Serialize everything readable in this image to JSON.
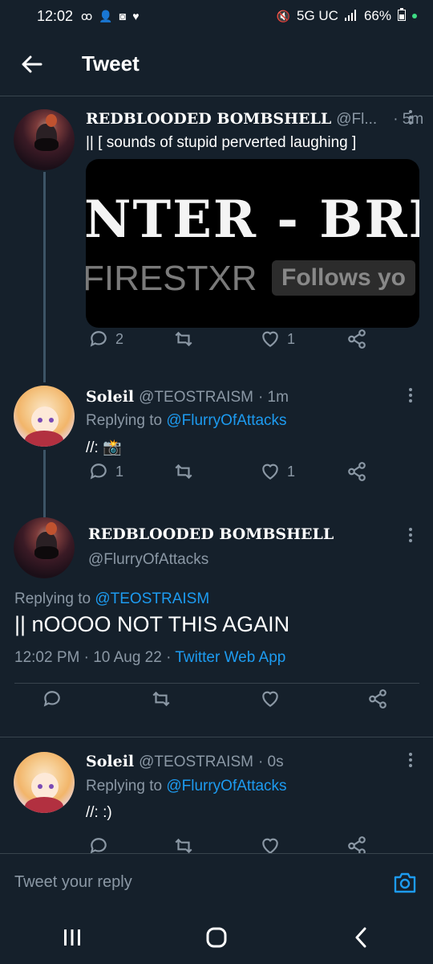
{
  "status_bar": {
    "time": "12:02",
    "left_icons": [
      "voicemail-icon",
      "add-person-icon",
      "discord-icon",
      "heart-icon"
    ],
    "network": "5G UC",
    "battery": "66%"
  },
  "header": {
    "title": "Tweet"
  },
  "tweets": [
    {
      "name": "REDBLOODED BOMBSHELL",
      "handle": "@Fl...",
      "time": "· 5m",
      "text": "|| [ sounds of stupid perverted laughing ]",
      "media": {
        "line1": "NTER - BREA",
        "line2": "FIRESTXR",
        "badge": "Follows yo"
      },
      "replies": "2",
      "retweets": "",
      "likes": "1"
    },
    {
      "name": "Soleil",
      "handle": "@TEOSTRAISM",
      "time": "· 1m",
      "replying_prefix": "Replying to ",
      "replying_to": "@FlurryOfAttacks",
      "text": "//: 📸",
      "replies": "1",
      "retweets": "",
      "likes": "1"
    }
  ],
  "main_tweet": {
    "name": "REDBLOODED BOMBSHELL",
    "handle": "@FlurryOfAttacks",
    "replying_prefix": "Replying to ",
    "replying_to": "@TEOSTRAISM",
    "text": "|| nOOOO NOT THIS AGAIN",
    "timestamp": "12:02 PM · 10 Aug 22 · ",
    "source": "Twitter Web App"
  },
  "last_reply": {
    "name": "Soleil",
    "handle": "@TEOSTRAISM",
    "time": "· 0s",
    "replying_prefix": "Replying to ",
    "replying_to": "@FlurryOfAttacks",
    "text": "//: :)"
  },
  "reply_box": {
    "placeholder": "Tweet your reply"
  },
  "colors": {
    "background": "#15202b",
    "accent": "#1d9bf0",
    "muted": "#8b98a5",
    "border": "#38444d"
  }
}
